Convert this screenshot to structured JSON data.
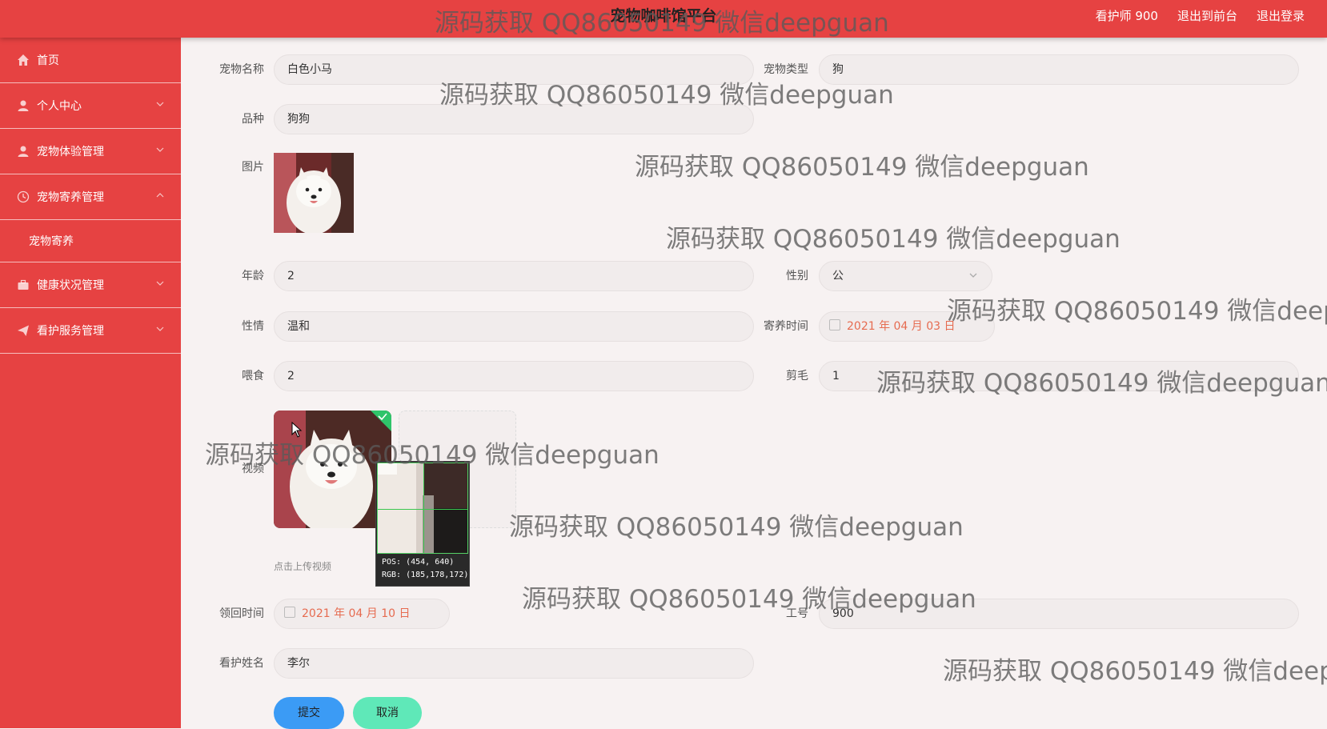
{
  "header": {
    "title": "宠物咖啡馆平台",
    "user": "看护师 900",
    "back_to_front": "退出到前台",
    "logout": "退出登录"
  },
  "sidebar": {
    "items": [
      {
        "label": "首页",
        "icon": "home-icon"
      },
      {
        "label": "个人中心",
        "icon": "user-icon"
      },
      {
        "label": "宠物体验管理",
        "icon": "user-icon"
      },
      {
        "label": "宠物寄养管理",
        "icon": "clock-icon"
      },
      {
        "label": "宠物寄养",
        "icon": ""
      },
      {
        "label": "健康状况管理",
        "icon": "briefcase-icon"
      },
      {
        "label": "看护服务管理",
        "icon": "send-icon"
      }
    ]
  },
  "form": {
    "pet_name_label": "宠物名称",
    "pet_name_value": "白色小马",
    "pet_type_label": "宠物类型",
    "pet_type_value": "狗",
    "breed_label": "品种",
    "breed_value": "狗狗",
    "image_label": "图片",
    "age_label": "年龄",
    "age_value": "2",
    "gender_label": "性别",
    "gender_value": "公",
    "temperament_label": "性情",
    "temperament_value": "温和",
    "boarding_time_label": "寄养时间",
    "boarding_time_value": "2021 年 04 月 03 日",
    "feeding_label": "喂食",
    "feeding_value": "2",
    "grooming_label": "剪毛",
    "grooming_value": "1",
    "video_label": "视频",
    "upload_tip": "点击上传视频",
    "pickup_time_label": "领回时间",
    "pickup_time_value": "2021 年 04 月 10 日",
    "staff_no_label": "工号",
    "staff_no_value": "900",
    "caretaker_label": "看护姓名",
    "caretaker_value": "李尔",
    "submit": "提交",
    "cancel": "取消"
  },
  "magnifier": {
    "pos": "POS: (454, 640)",
    "rgb": "RGB: (185,178,172)"
  },
  "watermark": "源码获取 QQ86050149 微信deepguan",
  "colors": {
    "primary": "#e64242",
    "submit": "#3b9bf5",
    "cancel": "#5fe8b8",
    "date_text": "#e66b50"
  }
}
